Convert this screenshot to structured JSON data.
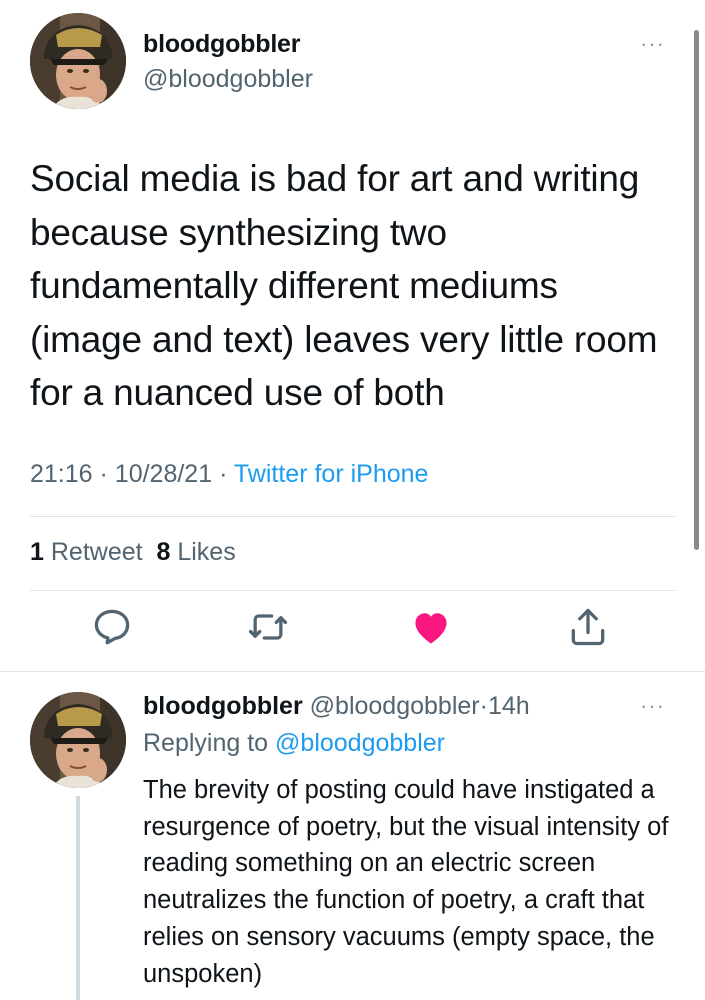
{
  "main_tweet": {
    "display_name": "bloodgobbler",
    "handle": "@bloodgobbler",
    "more_label": "···",
    "text": "Social media is bad for art and writing because synthesizing two fundamentally different mediums (image and text) leaves very little room for a nuanced use of both",
    "time": "21:16",
    "date": "10/28/21",
    "separator": "·",
    "source": "Twitter for iPhone",
    "retweet_count": "1",
    "retweet_label": "Retweet",
    "like_count": "8",
    "like_label": "Likes",
    "actions": {
      "reply_icon": "reply-icon",
      "retweet_icon": "retweet-icon",
      "like_icon": "heart-filled-icon",
      "share_icon": "share-icon"
    }
  },
  "reply_tweet": {
    "display_name": "bloodgobbler",
    "handle": "@bloodgobbler",
    "separator": "·",
    "time": "14h",
    "more_label": "···",
    "replying_prefix": "Replying to",
    "replying_to": "@bloodgobbler",
    "text": "The brevity of posting could have instigated a resurgence of poetry, but the visual intensity of reading something on an electric screen neutralizes the function of poetry, a craft that relies on sensory vacuums (empty space, the unspoken)"
  },
  "colors": {
    "link": "#1d9bf0",
    "secondary_text": "#536471",
    "like": "#f91880",
    "divider": "#dfe3e6"
  }
}
